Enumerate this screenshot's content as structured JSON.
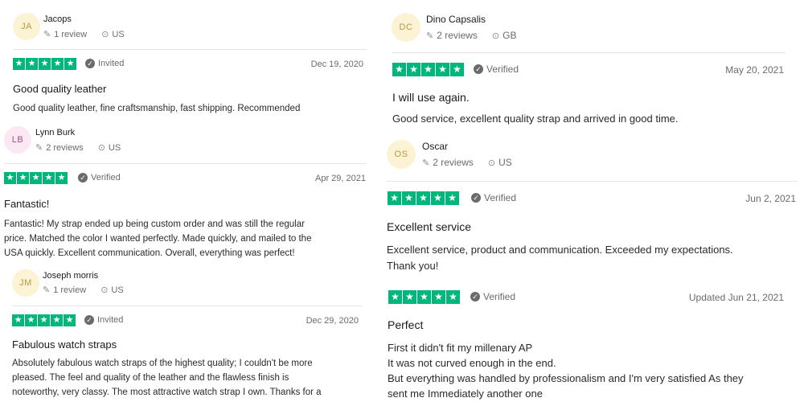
{
  "left": {
    "reviews": [
      {
        "initials": "JA",
        "name": "Jacops",
        "review_count": "1 review",
        "country": "US",
        "stars": 5,
        "status": "Invited",
        "date": "Dec 19, 2020",
        "title": "Good quality leather",
        "body": "Good quality leather, fine craftsmanship, fast shipping. Recommended"
      },
      {
        "initials": "LB",
        "name": "Lynn Burk",
        "review_count": "2 reviews",
        "country": "US",
        "stars": 5,
        "status": "Verified",
        "date": "Apr 29, 2021",
        "title": "Fantastic!",
        "body_lines": [
          "Fantastic! My strap ended up being custom order and was still the regular",
          "price. Matched the color I wanted perfectly. Made quickly, and mailed to the",
          "USA quickly. Excellent communication. Overall, everything was perfect!"
        ]
      },
      {
        "initials": "JM",
        "name": "Joseph morris",
        "review_count": "1 review",
        "country": "US",
        "stars": 5,
        "status": "Invited",
        "date": "Dec 29, 2020",
        "title": "Fabulous watch straps",
        "body_lines": [
          "Absolutely fabulous watch straps of the highest quality; I couldn't be more",
          "pleased. The feel and quality of the leather and the flawless finish is",
          "noteworthy, very classy. The most attractive watch strap I own. Thanks for a"
        ]
      }
    ]
  },
  "right": {
    "reviews": [
      {
        "initials": "DC",
        "name": "Dino Capsalis",
        "review_count": "2 reviews",
        "country": "GB",
        "stars": 5,
        "status": "Verified",
        "date": "May 20, 2021",
        "title": "I will use again.",
        "body": "Good service, excellent quality strap and arrived in good time."
      },
      {
        "initials": "OS",
        "name": "Oscar",
        "review_count": "2 reviews",
        "country": "US",
        "stars": 5,
        "status": "Verified",
        "date": "Jun 2, 2021",
        "title": "Excellent service",
        "body_lines": [
          "Excellent service, product and communication. Exceeded my expectations.",
          "Thank you!"
        ]
      },
      {
        "stars": 5,
        "status": "Verified",
        "date": "Updated Jun 21, 2021",
        "title": "Perfect",
        "body_lines": [
          "First it didn't fit my millenary AP",
          "It was not curved enough in the end.",
          "But everything was handled by professionalism and I'm very satisfied As they",
          "sent me Immediately another one"
        ]
      }
    ]
  },
  "colors": {
    "star_green": "#00b67a",
    "avatar_yellow_bg": "#fbf3d3",
    "avatar_pink_bg": "#fbe8f3"
  },
  "icons": {
    "review_count": "pencil-icon",
    "location": "location-pin-icon",
    "status": "check-circle-icon",
    "star": "star-icon"
  }
}
